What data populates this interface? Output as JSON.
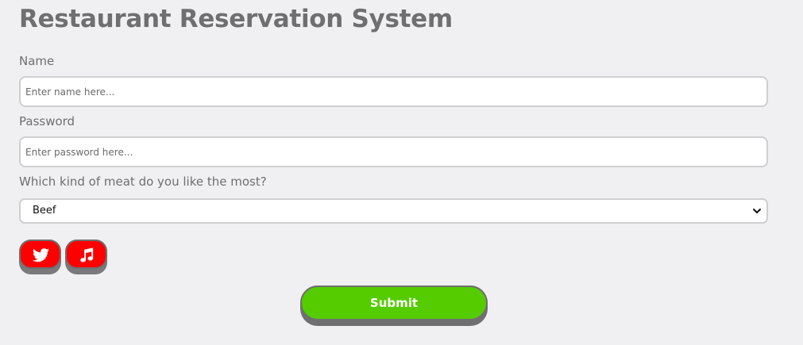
{
  "page": {
    "title": "Restaurant Reservation System"
  },
  "form": {
    "name_label": "Name",
    "name_placeholder": "Enter name here...",
    "name_value": "",
    "password_label": "Password",
    "password_placeholder": "Enter password here...",
    "password_value": "",
    "meat_label": "Which kind of meat do you like the most?",
    "meat_selected": "Beef",
    "submit_label": "Submit"
  },
  "social": [
    {
      "icon": "twitter-icon"
    },
    {
      "icon": "music-icon"
    }
  ],
  "colors": {
    "background": "#f0f0f2",
    "text": "#6f6f70",
    "social_button": "#ff0000",
    "submit_button": "#55cc00",
    "button_shadow": "#6f6f70"
  }
}
